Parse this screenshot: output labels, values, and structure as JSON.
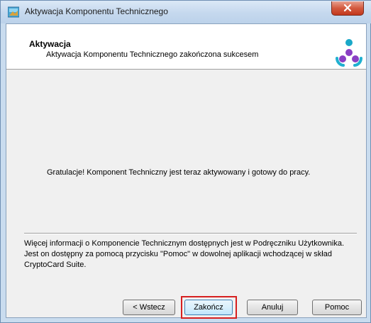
{
  "window": {
    "title": "Aktywacja Komponentu Technicznego"
  },
  "header": {
    "title": "Aktywacja",
    "subtitle": "Aktywacja Komponentu Technicznego zakończona sukcesem",
    "logo_colors": [
      "#1aa8c8",
      "#8a3fc4",
      "#20b0d0"
    ]
  },
  "body": {
    "message": "Gratulacje! Komponent Techniczny jest teraz aktywowany i gotowy do pracy.",
    "info": "Więcej informacji o Komponencie Technicznym dostępnych jest w Podręczniku Użytkownika. Jest on dostępny za pomocą przycisku \"Pomoc\" w dowolnej aplikacji wchodzącej w skład CryptoCard Suite."
  },
  "buttons": {
    "back": "< Wstecz",
    "finish": "Zakończ",
    "cancel": "Anuluj",
    "help": "Pomoc"
  },
  "colors": {
    "highlight": "#d62020",
    "close_button": "#c2371c"
  }
}
